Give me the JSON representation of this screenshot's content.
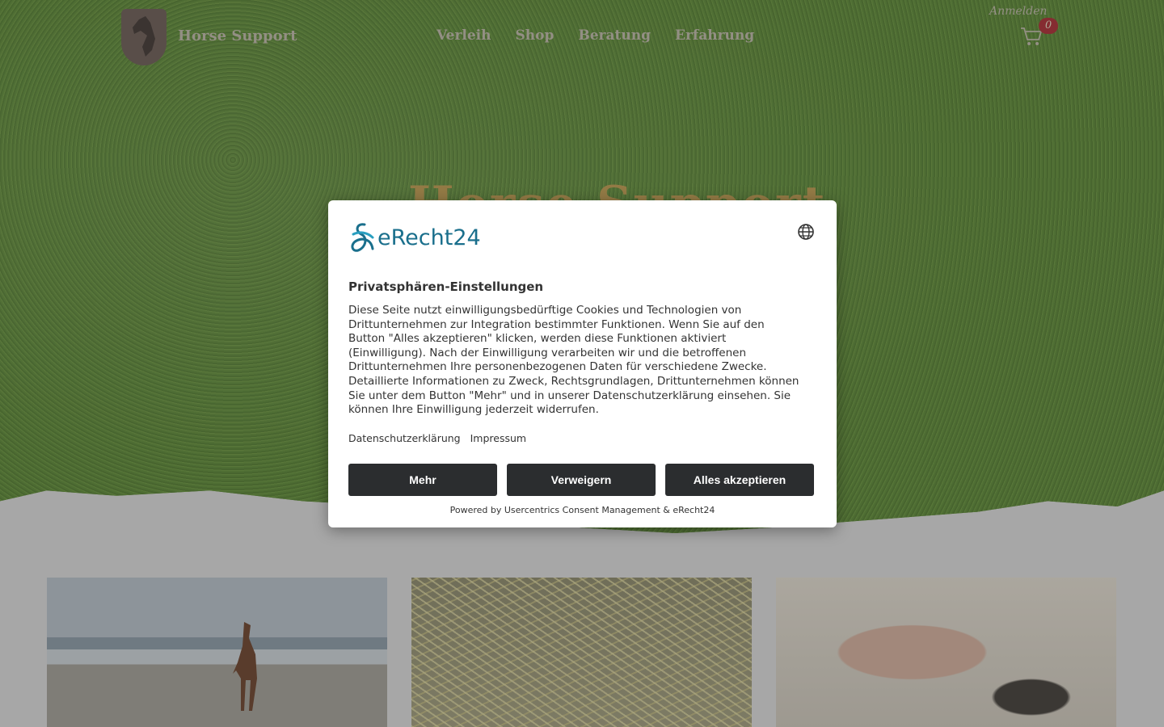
{
  "site": {
    "brand": "Horse Support",
    "hero_title": "Horse Support",
    "nav": [
      "Verleih",
      "Shop",
      "Beratung",
      "Erfahrung"
    ],
    "login": "Anmelden",
    "cart_count": "0"
  },
  "consent": {
    "logo_text": "eRecht24",
    "title": "Privatsphären-Einstellungen",
    "body": "Diese Seite nutzt einwilligungsbedürftige Cookies und Technologien von Drittunternehmen zur Integration bestimmter Funktionen. Wenn Sie auf den Button \"Alles akzeptieren\" klicken, werden diese Funktionen aktiviert (Einwilligung). Nach der Einwilligung verarbeiten wir und die betroffenen Drittunternehmen Ihre personenbezogenen Daten für verschiedene Zwecke. Detaillierte Informationen zu Zweck, Rechtsgrundlagen, Drittunternehmen können Sie unter dem Button \"Mehr\" und in unserer Datenschutzerklärung einsehen. Sie können Ihre Einwilligung jederzeit widerrufen.",
    "links": [
      "Datenschutzerklärung",
      "Impressum"
    ],
    "buttons": {
      "more": "Mehr",
      "deny": "Verweigern",
      "accept": "Alles akzeptieren"
    },
    "powered_by": "Powered by Usercentrics Consent Management & eRecht24"
  },
  "colors": {
    "accent_gold": "#c9a14b",
    "cart_badge": "#b2232b",
    "button_dark": "#2b2d2f",
    "erecht_blue": "#1a6f8c"
  }
}
